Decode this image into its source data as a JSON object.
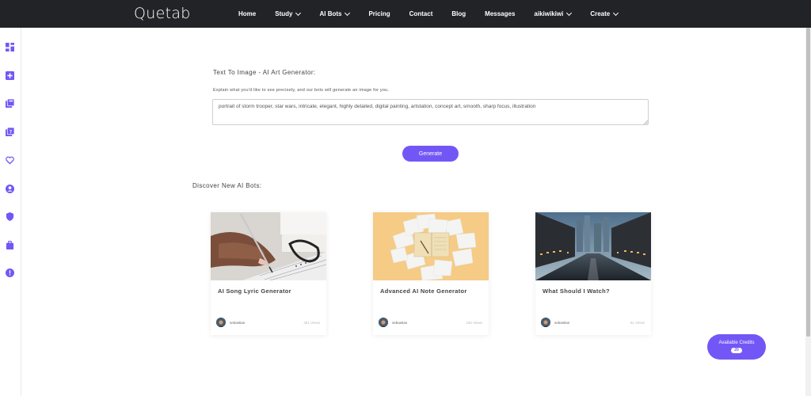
{
  "app": {
    "logo": "Quetab"
  },
  "nav": {
    "items": [
      {
        "label": "Home",
        "dropdown": false
      },
      {
        "label": "Study",
        "dropdown": true
      },
      {
        "label": "AI Bots",
        "dropdown": true
      },
      {
        "label": "Pricing",
        "dropdown": false
      },
      {
        "label": "Contact",
        "dropdown": false
      },
      {
        "label": "Blog",
        "dropdown": false
      },
      {
        "label": "Messages",
        "dropdown": false
      },
      {
        "label": "aikiwikiwi",
        "dropdown": true
      },
      {
        "label": "Create",
        "dropdown": true
      }
    ]
  },
  "sidebar": {
    "icons": [
      "dashboard-icon",
      "add-box-icon",
      "library-icon",
      "quiz-icon",
      "heart-icon",
      "account-circle-icon",
      "shield-icon",
      "briefcase-icon",
      "alert-circle-icon"
    ],
    "color": "#7357f6"
  },
  "generator": {
    "title": "Text To Image - AI Art Generator:",
    "description": "Explain what you'd like to see precisely, and our bots will generate an image for you.",
    "prompt": "portrait of storm trooper, star wars, intricate, elegant, highly detailed, digital painting, artstation, concept art, smooth, sharp focus, illustration",
    "button": "Generate"
  },
  "discover": {
    "title": "Discover New AI Bots:",
    "cards": [
      {
        "title": "AI Song Lyric Generator",
        "author": "sebastian",
        "views": "481 Views",
        "image": "hand-writing-notebook"
      },
      {
        "title": "Advanced AI Note Generator",
        "author": "sebastian",
        "views": "150 Views",
        "image": "notebook-papers"
      },
      {
        "title": "What Should I Watch?",
        "author": "sebastian",
        "views": "51 Views",
        "image": "city-street-night"
      }
    ]
  },
  "credits": {
    "label": "Available Credits",
    "count": "20"
  },
  "colors": {
    "accent": "#7357f6",
    "topbar": "#212326"
  }
}
